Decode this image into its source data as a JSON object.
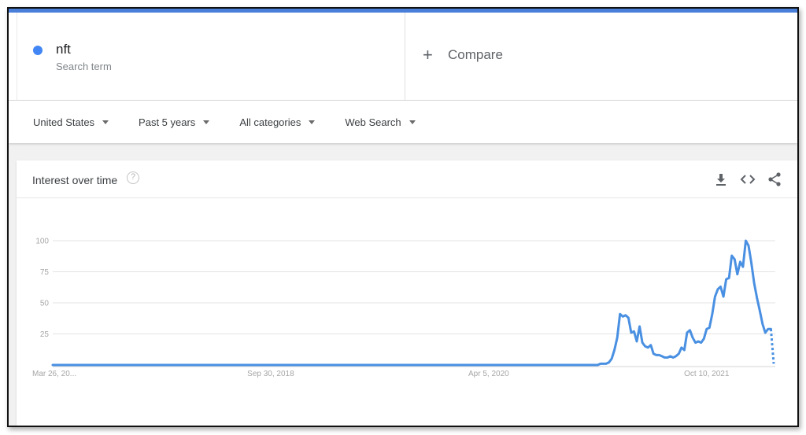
{
  "search_term": {
    "name": "nft",
    "subtitle": "Search term",
    "color": "#4285f4"
  },
  "compare": {
    "label": "Compare",
    "icon": "plus-icon"
  },
  "filters": [
    {
      "label": "United States"
    },
    {
      "label": "Past 5 years"
    },
    {
      "label": "All categories"
    },
    {
      "label": "Web Search"
    }
  ],
  "card": {
    "title": "Interest over time",
    "icons": [
      "help-icon",
      "download-icon",
      "embed-icon",
      "share-icon"
    ]
  },
  "chart_data": {
    "type": "line",
    "title": "Interest over time",
    "xlabel": "",
    "ylabel": "",
    "ylim": [
      0,
      100
    ],
    "yticks": [
      25,
      50,
      75,
      100
    ],
    "xtick_labels": [
      "Mar 26, 20...",
      "Sep 30, 2018",
      "Apr 5, 2020",
      "Oct 10, 2021"
    ],
    "xtick_index": [
      0,
      78,
      156,
      234
    ],
    "grid": true,
    "legend": "none",
    "series": [
      {
        "name": "nft",
        "color": "#4a90e2",
        "partial_last_point": true,
        "zero_weeks": 196,
        "values": [
          1,
          1,
          1,
          2,
          5,
          12,
          22,
          41,
          39,
          40,
          38,
          26,
          27,
          19,
          31,
          18,
          15,
          14,
          16,
          9,
          8,
          8,
          7,
          6,
          6,
          7,
          6,
          7,
          9,
          14,
          12,
          26,
          28,
          22,
          18,
          19,
          18,
          21,
          29,
          30,
          41,
          55,
          61,
          63,
          55,
          69,
          70,
          88,
          85,
          73,
          83,
          79,
          100,
          96,
          82,
          66,
          54,
          44,
          33,
          26,
          29,
          29,
          1
        ]
      }
    ]
  }
}
